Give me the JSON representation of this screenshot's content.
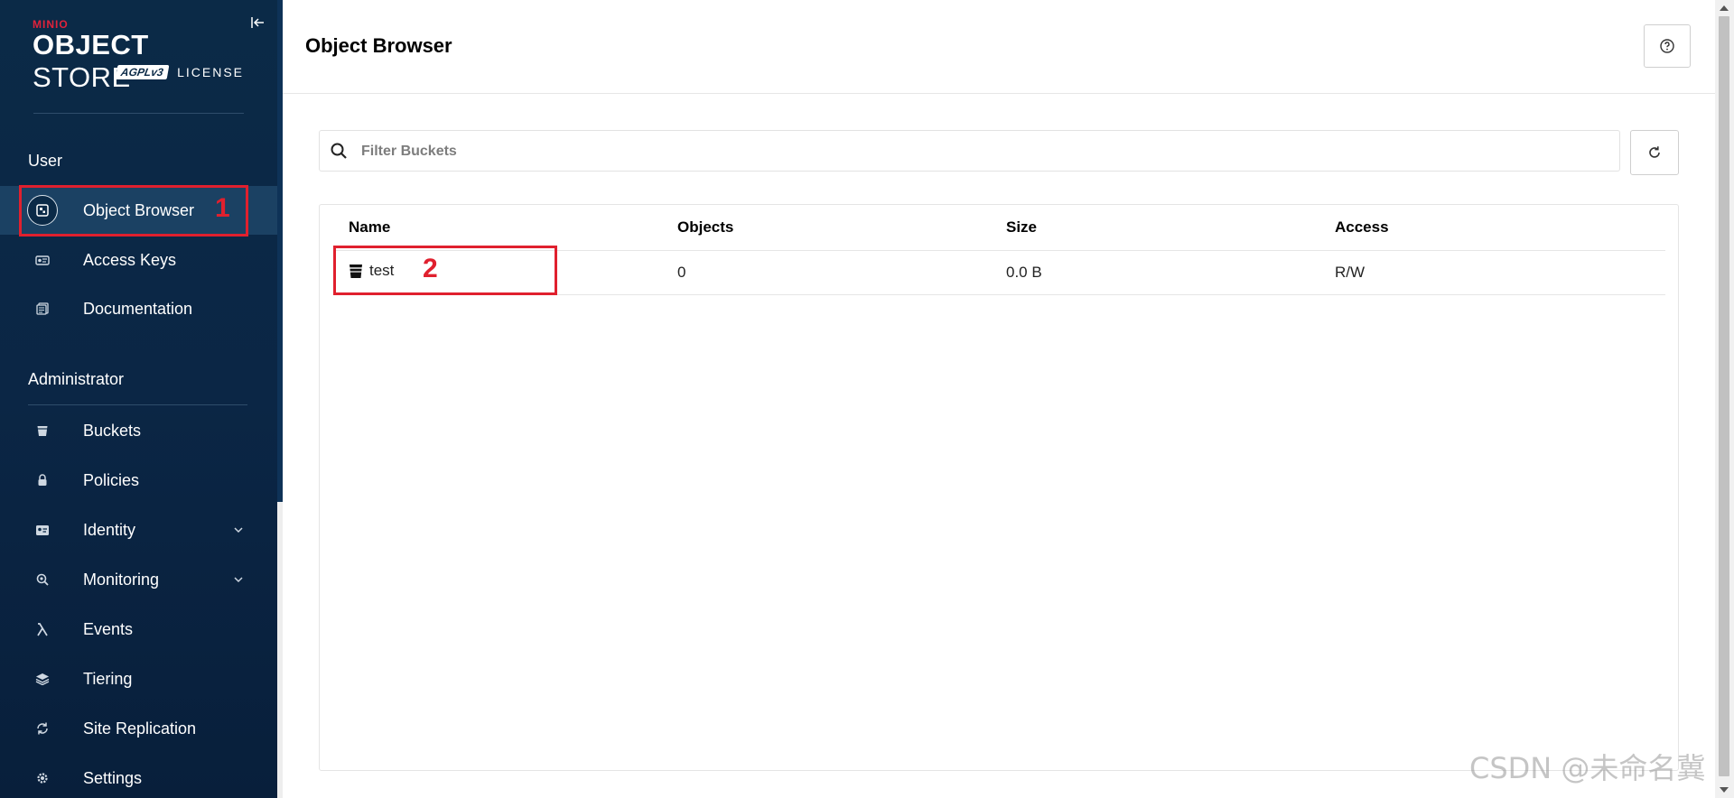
{
  "sidebar": {
    "logo": {
      "brand": "MINIO",
      "product_bold": "OBJECT",
      "product_light": "STORE",
      "license_badge": "AGPLv3",
      "license_text": "LICENSE"
    },
    "sections": [
      {
        "title": "User"
      },
      {
        "title": "Administrator"
      }
    ],
    "user_items": [
      {
        "label": "Object Browser",
        "icon": "object-browser-icon",
        "active": true
      },
      {
        "label": "Access Keys",
        "icon": "key-icon"
      },
      {
        "label": "Documentation",
        "icon": "document-icon"
      }
    ],
    "admin_items": [
      {
        "label": "Buckets",
        "icon": "bucket-icon"
      },
      {
        "label": "Policies",
        "icon": "lock-icon"
      },
      {
        "label": "Identity",
        "icon": "id-card-icon",
        "expandable": true
      },
      {
        "label": "Monitoring",
        "icon": "monitoring-icon",
        "expandable": true
      },
      {
        "label": "Events",
        "icon": "lambda-icon"
      },
      {
        "label": "Tiering",
        "icon": "layers-icon"
      },
      {
        "label": "Site Replication",
        "icon": "replication-icon"
      },
      {
        "label": "Settings",
        "icon": "gear-icon"
      }
    ]
  },
  "header": {
    "title": "Object Browser"
  },
  "filter": {
    "placeholder": "Filter Buckets",
    "value": ""
  },
  "table": {
    "columns": [
      "Name",
      "Objects",
      "Size",
      "Access"
    ],
    "rows": [
      {
        "name": "test",
        "objects": "0",
        "size": "0.0 B",
        "access": "R/W"
      }
    ]
  },
  "annotations": {
    "first": "1",
    "second": "2"
  },
  "watermark": "CSDN @未命名冀",
  "colors": {
    "sidebar_bg": "#0b2a47",
    "sidebar_active": "#1b4163",
    "annotation": "#e0202e",
    "brand_red": "#e0223b"
  }
}
